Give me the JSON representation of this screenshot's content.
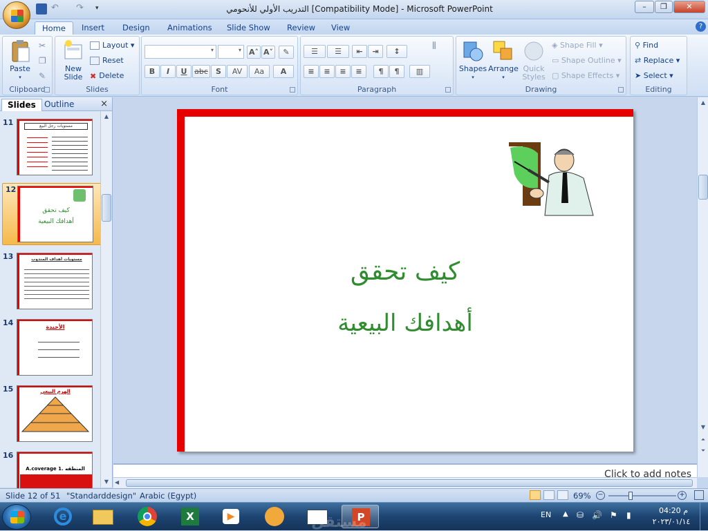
{
  "window": {
    "title": "التدريب الأولي للأنحومي [Compatibility Mode] - Microsoft PowerPoint",
    "minimize": "–",
    "maximize": "❐",
    "close": "✕"
  },
  "tabs": [
    "Home",
    "Insert",
    "Design",
    "Animations",
    "Slide Show",
    "Review",
    "View"
  ],
  "ribbon": {
    "clipboard": {
      "label": "Clipboard",
      "paste": "Paste"
    },
    "slides": {
      "label": "Slides",
      "new_slide": "New",
      "new_slide2": "Slide",
      "layout": "Layout",
      "reset": "Reset",
      "delete": "Delete"
    },
    "font": {
      "label": "Font",
      "bold": "B",
      "italic": "I",
      "underline": "U",
      "strike": "abc",
      "shadow": "S",
      "spacing": "AV",
      "case": "Aa",
      "color": "A"
    },
    "paragraph": {
      "label": "Paragraph"
    },
    "drawing": {
      "label": "Drawing",
      "shapes": "Shapes",
      "arrange": "Arrange",
      "quick_styles": "Quick",
      "quick_styles2": "Styles",
      "shape_fill": "Shape Fill",
      "shape_outline": "Shape Outline",
      "shape_effects": "Shape Effects"
    },
    "editing": {
      "label": "Editing",
      "find": "Find",
      "replace": "Replace",
      "select": "Select"
    }
  },
  "panel": {
    "tab_slides": "Slides",
    "tab_outline": "Outline",
    "close": "×",
    "thumbnails": [
      {
        "num": "11",
        "title": "مستويات رجل البيع"
      },
      {
        "num": "12",
        "title": "كيف تحقق",
        "subtitle": "أهدافك البيعية"
      },
      {
        "num": "13",
        "title": "مستويات أهداف المندوب"
      },
      {
        "num": "14",
        "title": "الأجندة"
      },
      {
        "num": "15",
        "title": "الهرم البيعي"
      },
      {
        "num": "16",
        "title": "A.coverage  المنطقه .1"
      }
    ]
  },
  "slide": {
    "title_line1": "كيف تحقق",
    "title_line2": "أهدافك البيعية",
    "image": "teacher-pointing-board-clipart"
  },
  "notes": {
    "placeholder": "Click to add notes"
  },
  "status": {
    "slide_info": "Slide 12 of 51",
    "theme": "\"Standarddesign\"",
    "language": "Arabic (Egypt)",
    "zoom": "69%",
    "zoom_level": 0.69
  },
  "taskbar": {
    "lang": "EN",
    "time": "04:20 م",
    "date": "٢٠٢٣/٠١/١٤",
    "watermark": "مستقل"
  },
  "colors": {
    "accent_red": "#e60000",
    "title_green": "#2f8c2f",
    "ribbon_text": "#15428b",
    "selected_thumb": "#f6b94c"
  }
}
